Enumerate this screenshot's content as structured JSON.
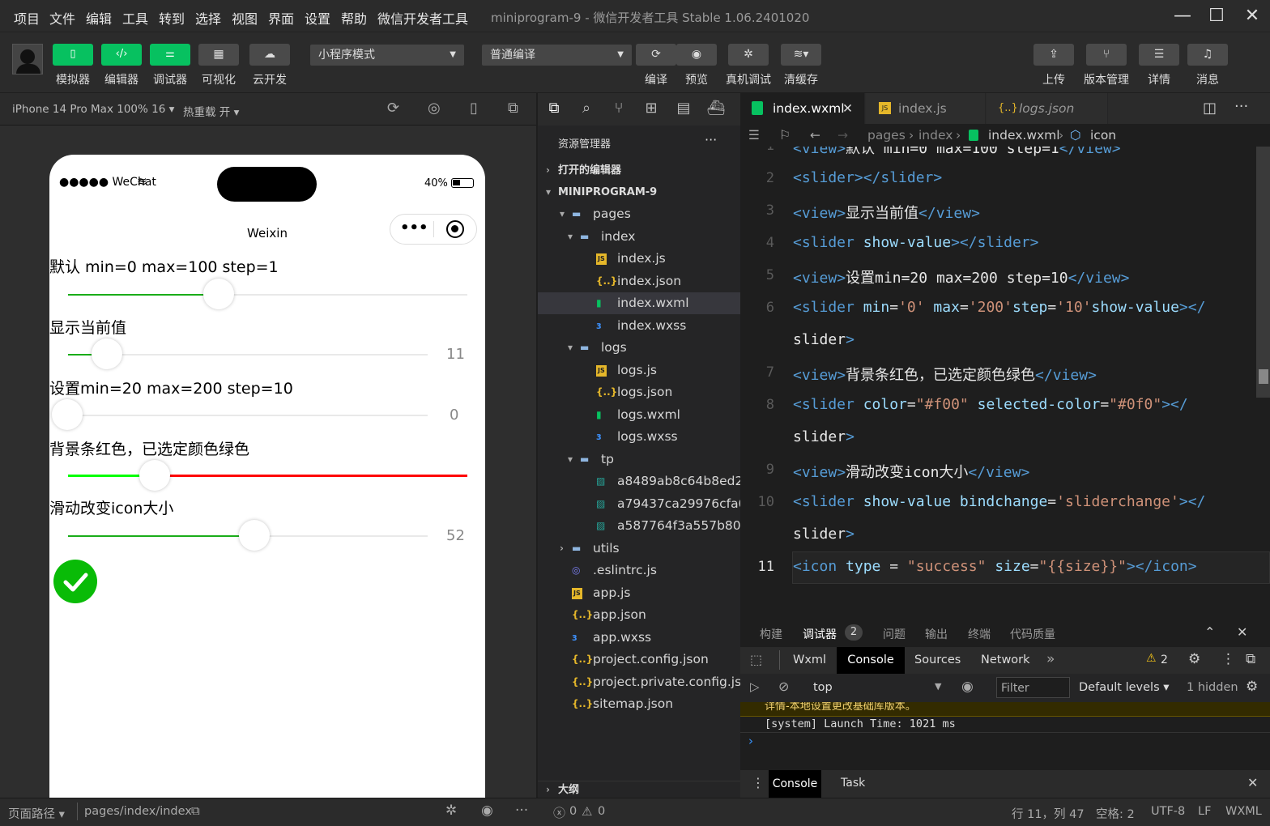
{
  "menu": [
    "项目",
    "文件",
    "编辑",
    "工具",
    "转到",
    "选择",
    "视图",
    "界面",
    "设置",
    "帮助",
    "微信开发者工具"
  ],
  "window_title": "miniprogram-9 - 微信开发者工具 Stable 1.06.2401020",
  "toolbar": {
    "left_buttons": [
      {
        "icon": "phone-icon",
        "label": "模拟器"
      },
      {
        "icon": "code-icon",
        "label": "编辑器"
      },
      {
        "icon": "debug-icon",
        "label": "调试器"
      },
      {
        "icon": "layout-icon",
        "label": "可视化"
      },
      {
        "icon": "cloud-icon",
        "label": "云开发"
      }
    ],
    "mode_select": "小程序模式",
    "compile_select": "普通编译",
    "mid_buttons": [
      {
        "icon": "refresh-icon",
        "label": "编译"
      },
      {
        "icon": "eye-icon",
        "label": "预览"
      },
      {
        "icon": "bug-icon",
        "label": "真机调试"
      },
      {
        "icon": "layers-icon",
        "label": "清缓存"
      }
    ],
    "right_buttons": [
      {
        "icon": "upload-icon",
        "label": "上传"
      },
      {
        "icon": "branch-icon",
        "label": "版本管理"
      },
      {
        "icon": "menu-icon",
        "label": "详情"
      },
      {
        "icon": "bell-icon",
        "label": "消息"
      }
    ]
  },
  "simulator": {
    "device": "iPhone 14 Pro Max 100% 16",
    "hot_reload": "热重载 开",
    "status_left": "●●●●● WeChat",
    "battery": "40%",
    "nav_title": "Weixin",
    "sections": [
      {
        "label": "默认 min=0 max=100 step=1"
      },
      {
        "label": "显示当前值",
        "value": "11"
      },
      {
        "label": "设置min=20 max=200 step=10",
        "value": "0"
      },
      {
        "label": "背景条红色，已选定颜色绿色"
      },
      {
        "label": "滑动改变icon大小",
        "value": "52"
      }
    ]
  },
  "explorer": {
    "title": "资源管理器",
    "more": "···",
    "open_editors": "打开的编辑器",
    "project": "MINIPROGRAM-9",
    "outline": "大纲",
    "tree": [
      {
        "name": "pages",
        "type": "folder"
      },
      {
        "name": "index",
        "type": "folder"
      },
      {
        "name": "index.js",
        "type": "js"
      },
      {
        "name": "index.json",
        "type": "json"
      },
      {
        "name": "index.wxml",
        "type": "wxml"
      },
      {
        "name": "index.wxss",
        "type": "wxss"
      },
      {
        "name": "logs",
        "type": "folder"
      },
      {
        "name": "logs.js",
        "type": "js"
      },
      {
        "name": "logs.json",
        "type": "json"
      },
      {
        "name": "logs.wxml",
        "type": "wxml"
      },
      {
        "name": "logs.wxss",
        "type": "wxss"
      },
      {
        "name": "tp",
        "type": "folder"
      },
      {
        "name": "a8489ab8c64b8ed2...",
        "type": "img"
      },
      {
        "name": "a79437ca29976cfa0...",
        "type": "img"
      },
      {
        "name": "a587764f3a557b802...",
        "type": "img"
      },
      {
        "name": "utils",
        "type": "folder"
      },
      {
        "name": ".eslintrc.js",
        "type": "eslint"
      },
      {
        "name": "app.js",
        "type": "js"
      },
      {
        "name": "app.json",
        "type": "json"
      },
      {
        "name": "app.wxss",
        "type": "wxss"
      },
      {
        "name": "project.config.json",
        "type": "json"
      },
      {
        "name": "project.private.config.js...",
        "type": "json"
      },
      {
        "name": "sitemap.json",
        "type": "json"
      }
    ]
  },
  "editor": {
    "tabs": [
      "index.wxml",
      "index.js",
      "logs.json"
    ],
    "breadcrumb": [
      "pages",
      "index",
      "index.wxml",
      "icon"
    ],
    "code_lines": [
      {
        "n": "1",
        "text": "<view>默认 min=0 max=100 step=1</view>"
      },
      {
        "n": "2",
        "text": "<slider></slider>"
      },
      {
        "n": "3",
        "text": "<view>显示当前值</view>"
      },
      {
        "n": "4",
        "text": "<slider show-value></slider>"
      },
      {
        "n": "5",
        "text": "<view>设置min=20 max=200 step=10</view>"
      },
      {
        "n": "6",
        "text": "<slider min='0' max='200'step='10'show-value></"
      },
      {
        "n": "",
        "text": "slider>"
      },
      {
        "n": "7",
        "text": "<view>背景条红色，已选定颜色绿色</view>"
      },
      {
        "n": "8",
        "text": "<slider color=\"#f00\" selected-color=\"#0f0\"></"
      },
      {
        "n": "",
        "text": "slider>"
      },
      {
        "n": "9",
        "text": "<view>滑动改变icon大小</view>"
      },
      {
        "n": "10",
        "text": "<slider show-value bindchange='sliderchange'></"
      },
      {
        "n": "",
        "text": "slider>"
      },
      {
        "n": "11",
        "text": "<icon type = \"success\" size=\"{{size}}\"></icon>"
      }
    ]
  },
  "panel": {
    "tabs": [
      "构建",
      "调试器",
      "问题",
      "输出",
      "终端",
      "代码质量"
    ],
    "debugger_badge": "2",
    "devtools_tabs": [
      "Wxml",
      "Console",
      "Sources",
      "Network"
    ],
    "warnings": "2",
    "context": "top",
    "filter_placeholder": "Filter",
    "levels": "Default levels",
    "hidden": "1 hidden",
    "log_line_1": "详情-本地设置更改基础库版本。",
    "log_line_2": "[system] Launch Time: 1021 ms",
    "drawer_tabs": [
      "Console",
      "Task"
    ]
  },
  "status": {
    "page_path_label": "页面路径",
    "page_path": "pages/index/index",
    "errors": "0",
    "warnings": "0",
    "cursor": "行 11，列 47",
    "spaces": "空格: 2",
    "encoding": "UTF-8",
    "lf": "LF",
    "lang": "WXML"
  },
  "colors": {
    "accent": "#07c160",
    "slider_green": "#1aad19",
    "slider_red": "#ff0000"
  }
}
